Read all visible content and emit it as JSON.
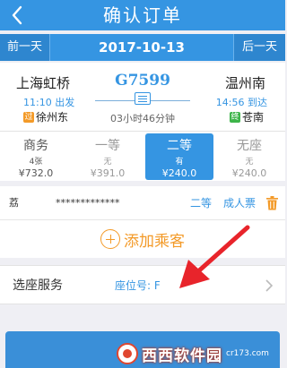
{
  "header": {
    "title": "确认订单",
    "back_icon": "chevron-left-icon"
  },
  "date_bar": {
    "prev_label": "前一天",
    "date": "2017-10-13",
    "next_label": "后一天"
  },
  "train": {
    "number": "G7599",
    "from": {
      "station": "上海虹桥",
      "time": "11:10",
      "status": "出发",
      "via_badge": "过",
      "via": "徐州东"
    },
    "to": {
      "station": "温州南",
      "time": "14:56",
      "status": "到达",
      "via_badge": "终",
      "via": "苍南"
    },
    "duration": "03小时46分钟"
  },
  "seats": [
    {
      "name": "商务",
      "count": "4张",
      "price": "¥732.0"
    },
    {
      "name": "一等",
      "count": "无",
      "price": "¥391.0"
    },
    {
      "name": "二等",
      "count": "有",
      "price": "¥240.0",
      "selected": true
    },
    {
      "name": "无座",
      "count": "无",
      "price": "¥240.0"
    }
  ],
  "passenger": {
    "name": "荔",
    "id_number": "*************",
    "seat_class": "二等",
    "ticket_type": "成人票"
  },
  "add_passenger_label": "添加乘客",
  "seat_service": {
    "label": "选座服务",
    "value": "座位号: F"
  },
  "watermark": {
    "brand": "西西软件园",
    "sub": "cr173.com"
  },
  "colors": {
    "primary": "#3595e2",
    "accent": "#f39a28",
    "arrow": "#e8242b"
  }
}
